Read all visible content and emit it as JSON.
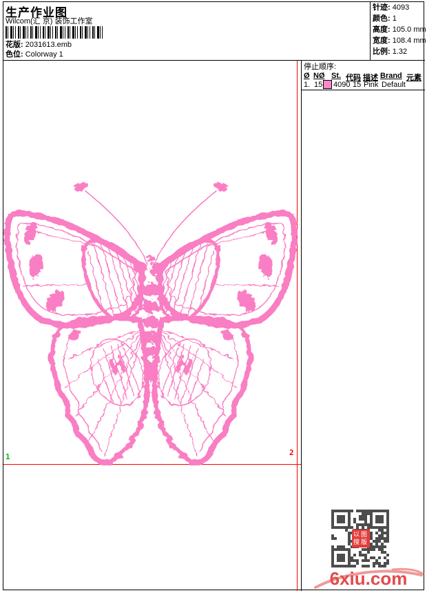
{
  "header": {
    "title": "生产作业图",
    "company": "Wilcom(汇 京) 装饰工作室",
    "design_label": "花版:",
    "design_value": "2031613.emb",
    "colorway_label": "色位:",
    "colorway_value": "Colorway 1"
  },
  "stats": {
    "rows": [
      {
        "label": "针迹:",
        "value": "4093"
      },
      {
        "label": "颜色:",
        "value": "1"
      },
      {
        "label": "高度:",
        "value": "105.0 mm"
      },
      {
        "label": "宽度:",
        "value": "108.4 mm"
      },
      {
        "label": "比例:",
        "value": "1.32"
      }
    ]
  },
  "stop_sequence": {
    "title": "停止顺序:",
    "headers": {
      "num": "Ø",
      "needle": "NØ",
      "st": "St.",
      "code": "代码",
      "desc": "描述",
      "brand": "Brand",
      "elements": "元素"
    },
    "row": {
      "num": "1.",
      "needle": "15",
      "swatch_color": "#ff87ca",
      "st": "4090",
      "code": "15",
      "desc": "Pink",
      "brand": "Default",
      "elements": ""
    }
  },
  "design": {
    "stitch_color": "#f97ec3",
    "guide_color": "#ff0000",
    "start_marker": {
      "label": "1",
      "color": "#00bb00"
    },
    "end_marker": {
      "label": "2",
      "color": "#ff0000"
    }
  },
  "watermark": {
    "site": "6xiu.com",
    "color": "#e24b4b",
    "qr_stamp": "以图搜版"
  }
}
